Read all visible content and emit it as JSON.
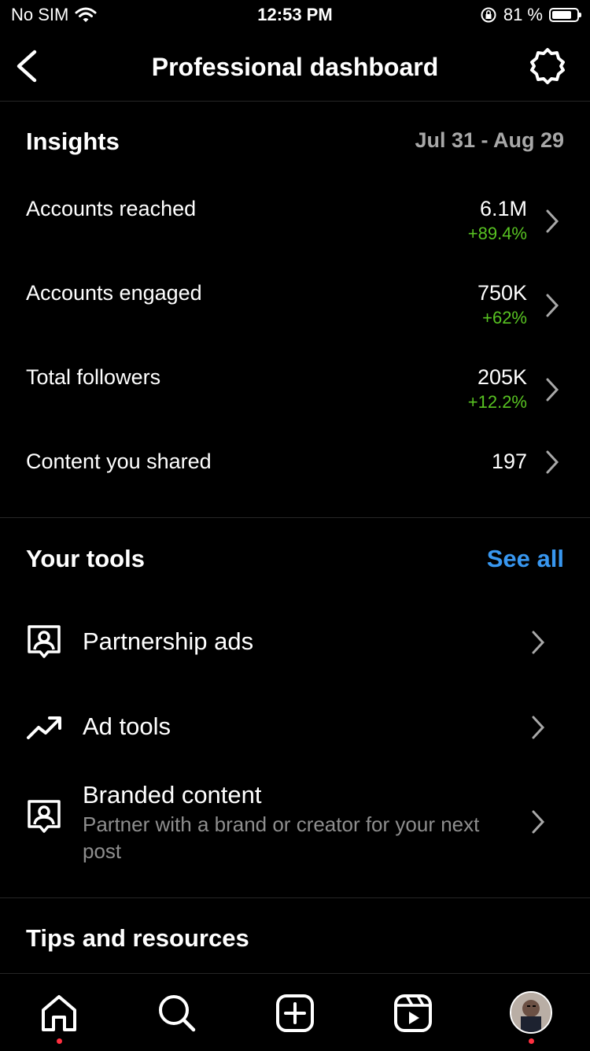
{
  "status_bar": {
    "carrier": "No SIM",
    "time": "12:53 PM",
    "battery": "81 %",
    "battery_level": 0.81
  },
  "header": {
    "title": "Professional dashboard",
    "back_icon": "chevron-left-icon",
    "settings_icon": "gear-icon"
  },
  "insights": {
    "title": "Insights",
    "date_range": "Jul 31 - Aug 29",
    "metrics": [
      {
        "label": "Accounts reached",
        "value": "6.1M",
        "change": "+89.4%"
      },
      {
        "label": "Accounts engaged",
        "value": "750K",
        "change": "+62%"
      },
      {
        "label": "Total followers",
        "value": "205K",
        "change": "+12.2%"
      },
      {
        "label": "Content you shared",
        "value": "197",
        "change": ""
      }
    ]
  },
  "tools": {
    "title": "Your tools",
    "see_all": "See all",
    "items": [
      {
        "label": "Partnership ads",
        "icon": "partnership-icon",
        "sub": ""
      },
      {
        "label": "Ad tools",
        "icon": "trending-up-icon",
        "sub": ""
      },
      {
        "label": "Branded content",
        "icon": "branded-content-icon",
        "sub": "Partner with a brand or creator for your next post"
      }
    ]
  },
  "tips": {
    "title": "Tips and resources"
  },
  "nav": {
    "items": [
      "home-icon",
      "search-icon",
      "create-icon",
      "reels-icon",
      "profile-avatar"
    ],
    "accent": "#ff3040"
  },
  "colors": {
    "positive": "#58c322",
    "link": "#3897f0",
    "muted": "#a8a8a8"
  }
}
